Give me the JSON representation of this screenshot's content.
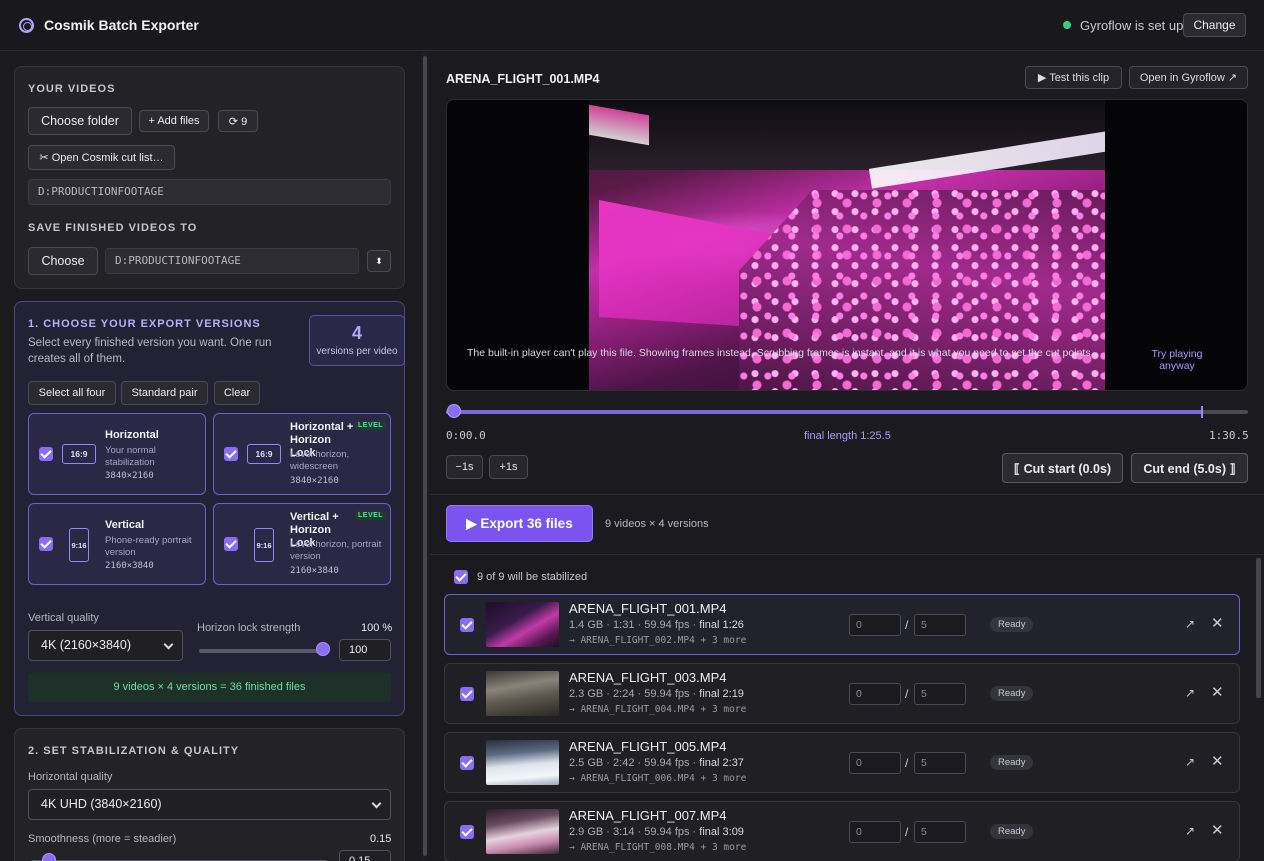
{
  "app": {
    "title": "Cosmik Batch Exporter",
    "gyro_status": "Gyroflow is set up",
    "change_label": "Change"
  },
  "colors": {
    "accent": "#8b6cf5",
    "status_ok": "#35d07f",
    "bg": "#1b1b1f"
  },
  "videos": {
    "title": "YOUR VIDEOS",
    "choose_folder": "Choose folder",
    "add_files": "+ Add files",
    "refresh_count": "⟳ 9",
    "open_cut_list": "✂ Open Cosmik cut list…",
    "source_path": "D:PRODUCTIONFOOTAGE"
  },
  "save": {
    "title": "SAVE FINISHED VIDEOS TO",
    "choose": "Choose",
    "path": "D:PRODUCTIONFOOTAGE",
    "swap_icon": "⬍"
  },
  "versions": {
    "title": "1. CHOOSE YOUR EXPORT VERSIONS",
    "help": "Select every finished version you want. One run creates all of them.",
    "count": "4",
    "count_label": "versions per video",
    "select_all": "Select all four",
    "standard_pair": "Standard pair",
    "clear": "Clear",
    "options": [
      {
        "ratio": "16:9",
        "title": "Horizontal",
        "sub": "Your normal stabilization",
        "res": "3840×2160",
        "badge": ""
      },
      {
        "ratio": "16:9",
        "title": "Horizontal + Horizon Lock",
        "sub": "Level horizon, widescreen",
        "res": "3840×2160",
        "badge": "LEVEL"
      },
      {
        "ratio": "9:16",
        "title": "Vertical",
        "sub": "Phone-ready portrait version",
        "res": "2160×3840",
        "badge": ""
      },
      {
        "ratio": "9:16",
        "title": "Vertical + Horizon Lock",
        "sub": "Level horizon, portrait version",
        "res": "2160×3840",
        "badge": "LEVEL"
      }
    ],
    "vertical_quality_label": "Vertical quality",
    "vertical_quality": "4K (2160×3840)",
    "horizon_lock_label": "Horizon lock strength",
    "horizon_lock_pct": "100 %",
    "horizon_lock_value": "100",
    "horizon_lock_level": 1.0,
    "summary": "9 videos × 4 versions = 36 finished files"
  },
  "stabilization": {
    "title": "2. SET STABILIZATION & QUALITY",
    "horizontal_quality_label": "Horizontal quality",
    "horizontal_quality": "4K UHD (3840×2160)",
    "smoothness_label": "Smoothness (more = steadier)",
    "smoothness_value": "0.15",
    "smoothness_input": "0.15"
  },
  "preview": {
    "clip_name": "ARENA_FLIGHT_001.MP4",
    "test_clip": "▶ Test this clip",
    "open_gyroflow": "Open in Gyroflow ↗",
    "player_message": "The built-in player can't play this file. Showing frames instead. Scrubbing frames is instant, and it is what you need to set the cut points.",
    "try_playing": "Try playing anyway",
    "time_start": "0:00.0",
    "final_length": "final length 1:25.5",
    "time_end": "1:30.5",
    "minus_1s": "−1s",
    "plus_1s": "+1s",
    "cut_start": "⟦ Cut start (0.0s)",
    "cut_end": "Cut end (5.0s) ⟧"
  },
  "export": {
    "button": "▶ Export 36 files",
    "sub": "9 videos × 4 versions"
  },
  "list": {
    "stabilized_label": "9 of 9 will be stabilized",
    "rows": [
      {
        "name": "ARENA_FLIGHT_001.MP4",
        "size": "1.4 GB",
        "dur": "1:31",
        "fps": "59.94 fps",
        "final": "final 1:26",
        "more": "→ ARENA_FLIGHT_002.MP4 + 3 more",
        "cut_start_ph": "0",
        "cut_end_ph": "5",
        "status": "Ready"
      },
      {
        "name": "ARENA_FLIGHT_003.MP4",
        "size": "2.3 GB",
        "dur": "2:24",
        "fps": "59.94 fps",
        "final": "final 2:19",
        "more": "→ ARENA_FLIGHT_004.MP4 + 3 more",
        "cut_start_ph": "0",
        "cut_end_ph": "5",
        "status": "Ready"
      },
      {
        "name": "ARENA_FLIGHT_005.MP4",
        "size": "2.5 GB",
        "dur": "2:42",
        "fps": "59.94 fps",
        "final": "final 2:37",
        "more": "→ ARENA_FLIGHT_006.MP4 + 3 more",
        "cut_start_ph": "0",
        "cut_end_ph": "5",
        "status": "Ready"
      },
      {
        "name": "ARENA_FLIGHT_007.MP4",
        "size": "2.9 GB",
        "dur": "3:14",
        "fps": "59.94 fps",
        "final": "final 3:09",
        "more": "→ ARENA_FLIGHT_008.MP4 + 3 more",
        "cut_start_ph": "0",
        "cut_end_ph": "5",
        "status": "Ready"
      }
    ]
  }
}
